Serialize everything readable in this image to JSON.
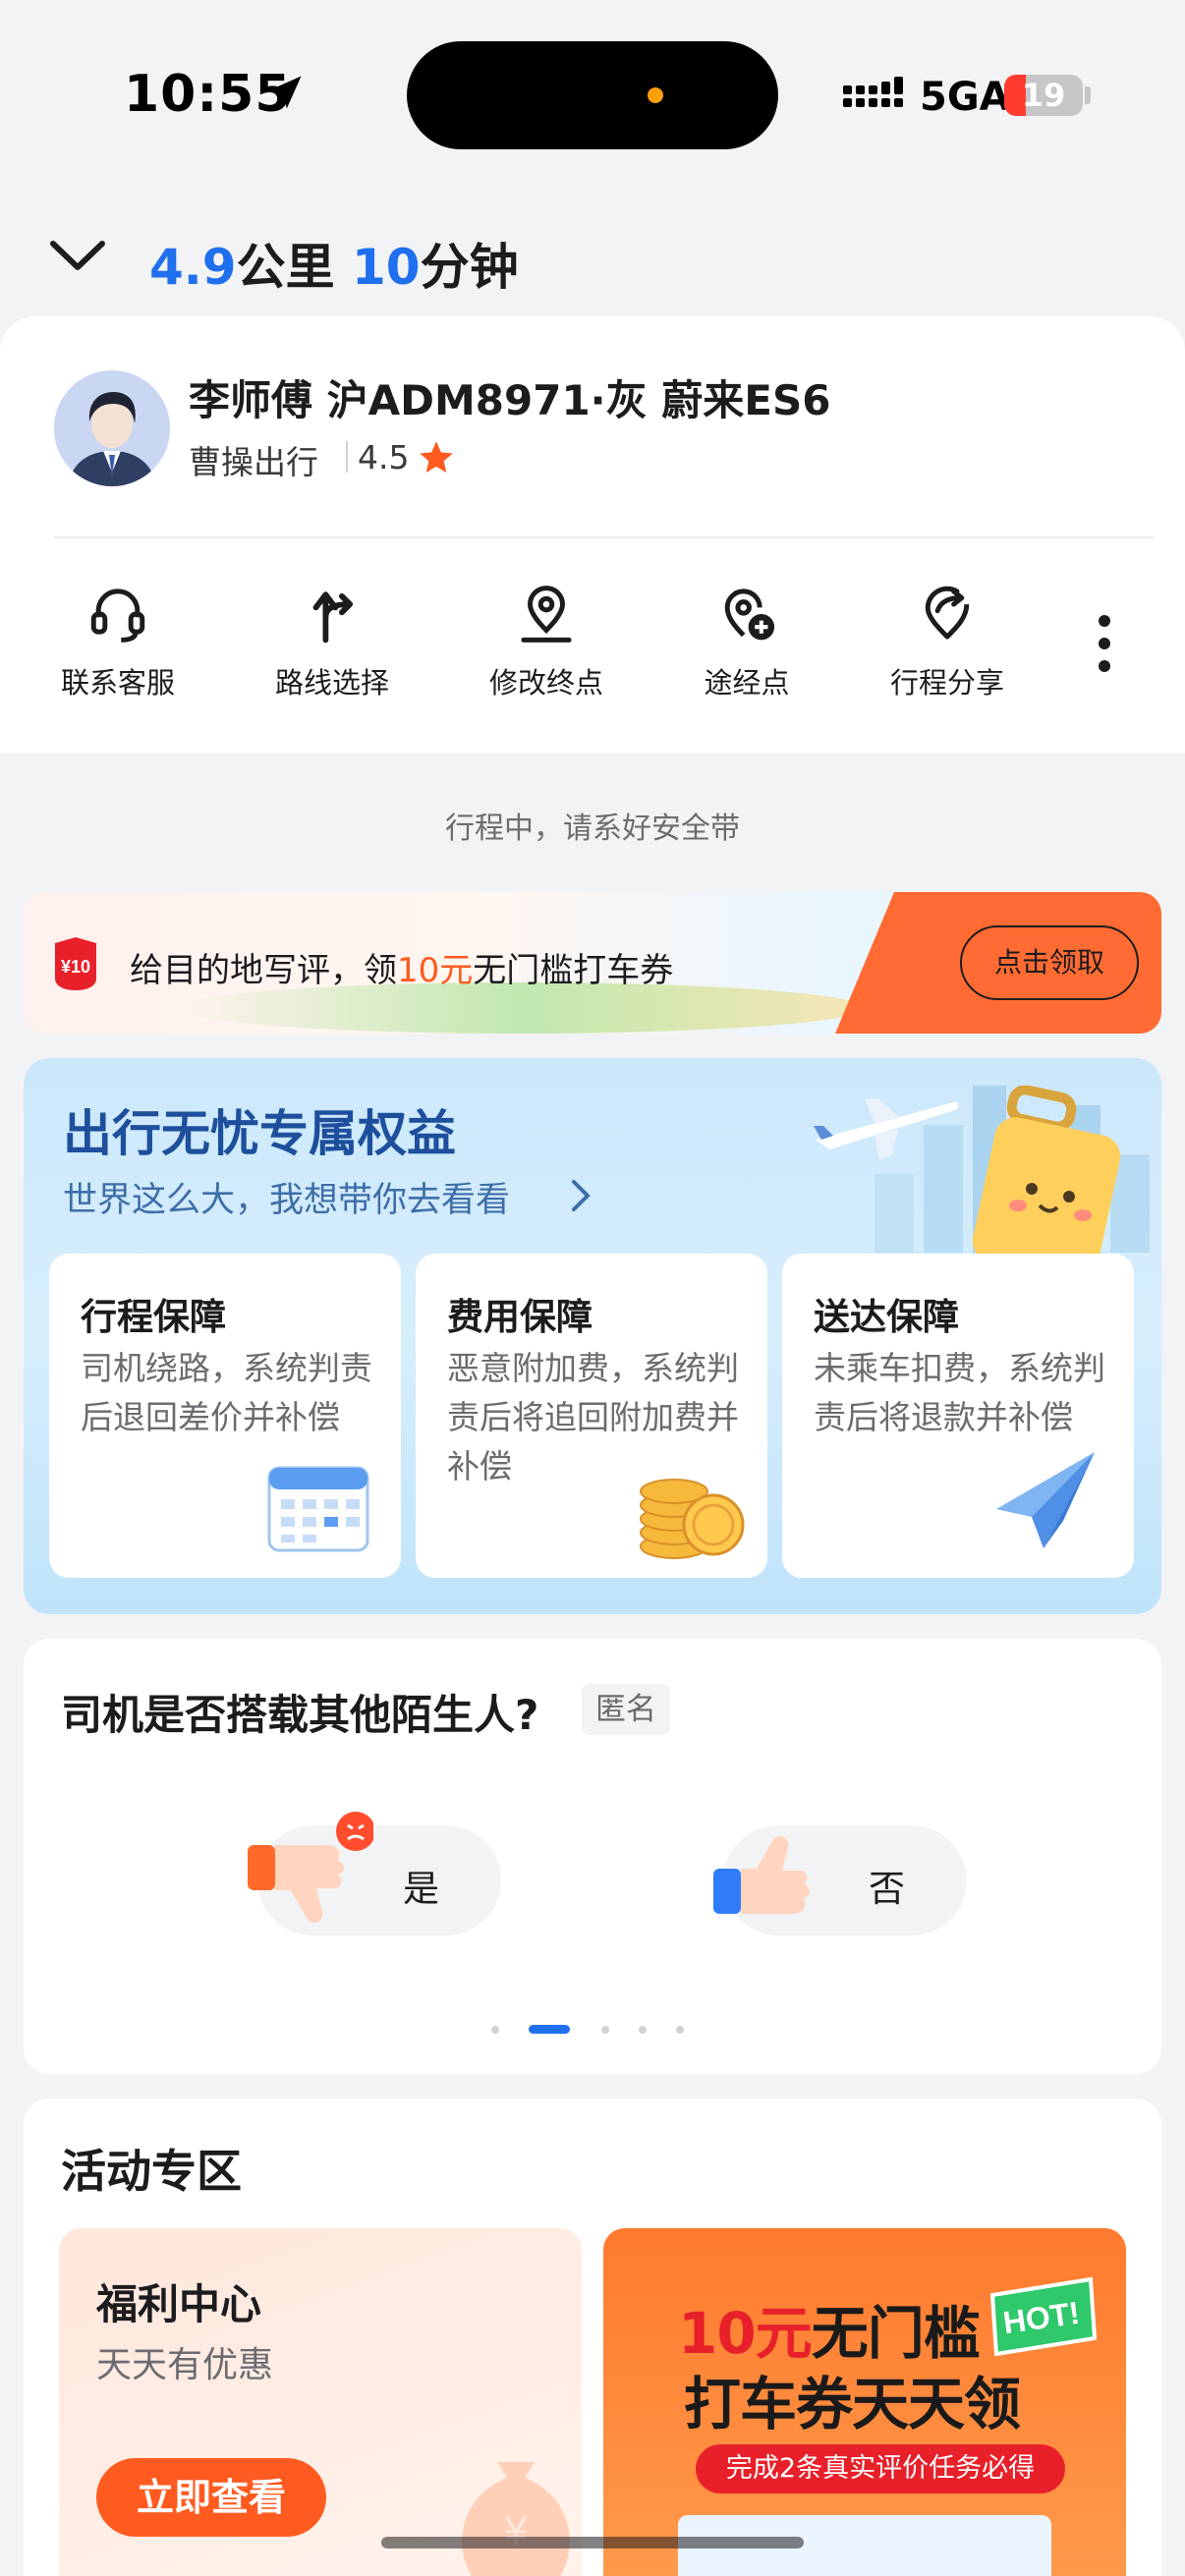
{
  "status_bar": {
    "time": "10:55",
    "network": "5GA",
    "battery": "19"
  },
  "trip": {
    "distance": "4.9",
    "distance_unit": "公里",
    "duration": "10",
    "duration_unit": "分钟"
  },
  "driver": {
    "name_plate": "李师傅 沪ADM8971·灰 蔚来ES6",
    "company": "曹操出行",
    "rating": "4.5"
  },
  "actions": [
    {
      "label": "联系客服",
      "icon": "headset-icon"
    },
    {
      "label": "路线选择",
      "icon": "route-icon"
    },
    {
      "label": "修改终点",
      "icon": "location-pin-icon"
    },
    {
      "label": "途经点",
      "icon": "add-stop-icon"
    },
    {
      "label": "行程分享",
      "icon": "share-location-icon"
    }
  ],
  "notice": "行程中，请系好安全带",
  "review_banner": {
    "text_before": "给目的地写评，领",
    "amount": "10元",
    "text_after": "无门槛打车券",
    "badge": "¥10",
    "button": "点击领取"
  },
  "benefits": {
    "title": "出行无忧专属权益",
    "subtitle": "世界这么大，我想带你去看看",
    "cards": [
      {
        "title": "行程保障",
        "desc": "司机绕路，系统判责后退回差价并补偿",
        "icon": "calendar-icon"
      },
      {
        "title": "费用保障",
        "desc": "恶意附加费，系统判责后将追回附加费并补偿",
        "icon": "coins-icon"
      },
      {
        "title": "送达保障",
        "desc": "未乘车扣费，系统判责后将退款并补偿",
        "icon": "paper-plane-icon"
      }
    ]
  },
  "survey": {
    "question": "司机是否搭载其他陌生人?",
    "tag": "匿名",
    "yes": "是",
    "no": "否",
    "carousel_active_index": 1,
    "carousel_count": 5
  },
  "activity": {
    "title": "活动专区",
    "welfare": {
      "title": "福利中心",
      "subtitle": "天天有优惠",
      "button": "立即查看"
    },
    "coupon": {
      "amount": "10元",
      "line1_rest": "无门槛",
      "line2": "打车券天天领",
      "hot": "HOT!",
      "note": "完成2条真实评价任务必得"
    }
  },
  "colors": {
    "accent_blue": "#1f6fee",
    "accent_orange": "#ff5a1f",
    "benefit_title": "#1d4f9c"
  }
}
